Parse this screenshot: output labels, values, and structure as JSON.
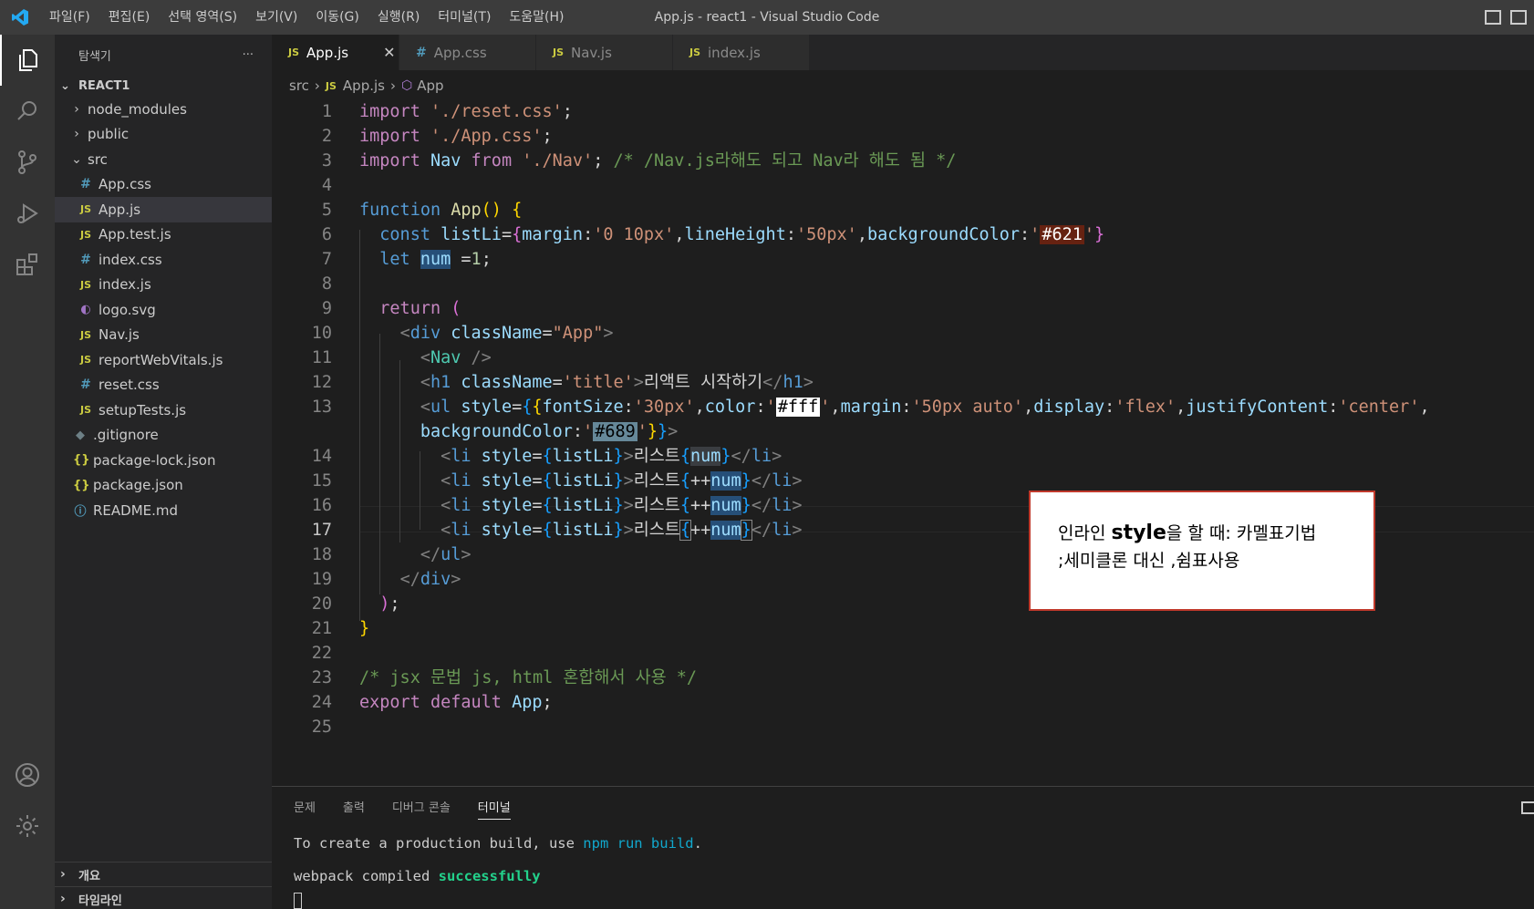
{
  "window": {
    "title": "App.js - react1 - Visual Studio Code"
  },
  "menu": [
    "파일(F)",
    "편집(E)",
    "선택 영역(S)",
    "보기(V)",
    "이동(G)",
    "실행(R)",
    "터미널(T)",
    "도움말(H)"
  ],
  "activity_bar": [
    "files-icon",
    "search-icon",
    "source-control-icon",
    "run-debug-icon",
    "extensions-icon",
    "account-icon",
    "settings-gear-icon"
  ],
  "sidebar": {
    "title": "탐색기",
    "more": "···",
    "project": "REACT1",
    "tree": [
      {
        "label": "node_modules",
        "type": "folder",
        "expanded": false,
        "depth": 1
      },
      {
        "label": "public",
        "type": "folder",
        "expanded": false,
        "depth": 1
      },
      {
        "label": "src",
        "type": "folder",
        "expanded": true,
        "depth": 1
      },
      {
        "label": "App.css",
        "type": "css",
        "icon": "#",
        "depth": 2
      },
      {
        "label": "App.js",
        "type": "js",
        "icon": "JS",
        "depth": 2,
        "selected": true
      },
      {
        "label": "App.test.js",
        "type": "js",
        "icon": "JS",
        "depth": 2
      },
      {
        "label": "index.css",
        "type": "css",
        "icon": "#",
        "depth": 2
      },
      {
        "label": "index.js",
        "type": "js",
        "icon": "JS",
        "depth": 2
      },
      {
        "label": "logo.svg",
        "type": "svg",
        "icon": "◐",
        "depth": 2
      },
      {
        "label": "Nav.js",
        "type": "js",
        "icon": "JS",
        "depth": 2
      },
      {
        "label": "reportWebVitals.js",
        "type": "js",
        "icon": "JS",
        "depth": 2
      },
      {
        "label": "reset.css",
        "type": "css",
        "icon": "#",
        "depth": 2
      },
      {
        "label": "setupTests.js",
        "type": "js",
        "icon": "JS",
        "depth": 2
      },
      {
        "label": ".gitignore",
        "type": "git",
        "icon": "◆",
        "depth": 1
      },
      {
        "label": "package-lock.json",
        "type": "json",
        "icon": "{}",
        "depth": 1
      },
      {
        "label": "package.json",
        "type": "json",
        "icon": "{}",
        "depth": 1
      },
      {
        "label": "README.md",
        "type": "info",
        "icon": "ⓘ",
        "depth": 1
      }
    ],
    "bottom_sections": [
      "개요",
      "타임라인"
    ]
  },
  "tabs": [
    {
      "label": "App.js",
      "icon": "JS",
      "active": true,
      "close": "✕"
    },
    {
      "label": "App.css",
      "icon": "#",
      "active": false
    },
    {
      "label": "Nav.js",
      "icon": "JS",
      "active": false
    },
    {
      "label": "index.js",
      "icon": "JS",
      "active": false
    }
  ],
  "breadcrumb": {
    "folder": "src",
    "file_icon": "JS",
    "file": "App.js",
    "symbol": "App"
  },
  "editor": {
    "current_line": 17,
    "line_numbers": [
      "1",
      "2",
      "3",
      "4",
      "5",
      "6",
      "7",
      "8",
      "9",
      "10",
      "11",
      "12",
      "13",
      "",
      "14",
      "15",
      "16",
      "17",
      "18",
      "19",
      "20",
      "21",
      "22",
      "23",
      "24",
      "25"
    ]
  },
  "note": {
    "line1_pre": "인라인 ",
    "line1_bold": "style",
    "line1_post": "을 할 때: 카멜표기법",
    "line2": ";세미클론 대신 ,쉼표사용"
  },
  "panel": {
    "tabs": [
      "문제",
      "출력",
      "디버그 콘솔",
      "터미널"
    ],
    "active_tab": "터미널",
    "terminal": {
      "line1_pre": "To create a production build, use ",
      "line1_cmd": "npm run build",
      "line1_post": ".",
      "line2_pre": "webpack compiled ",
      "line2_status": "successfully"
    }
  }
}
